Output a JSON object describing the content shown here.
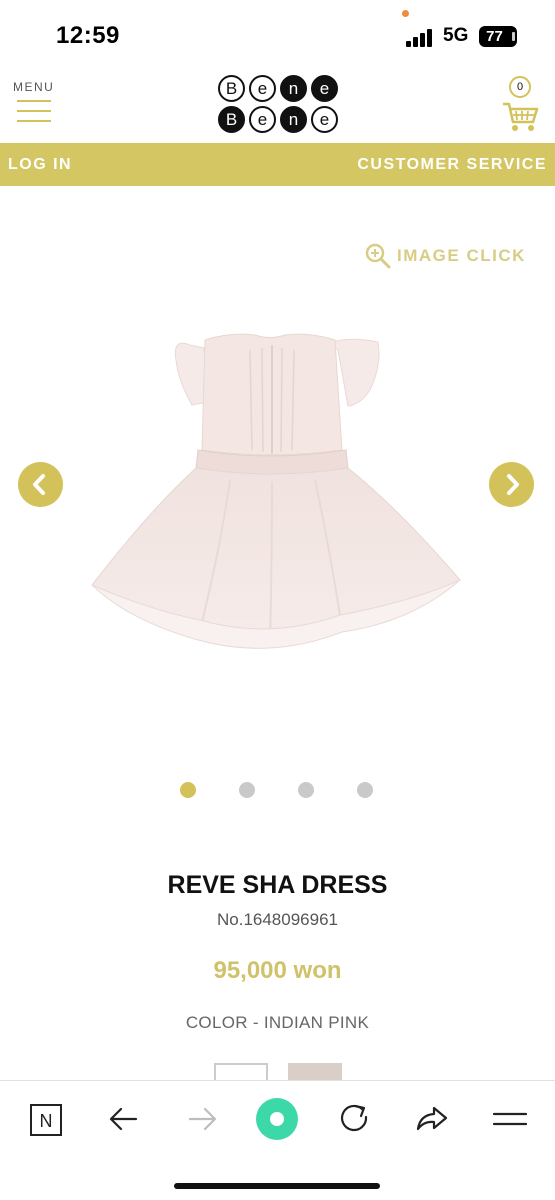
{
  "status_bar": {
    "time": "12:59",
    "network": "5G",
    "battery": "77"
  },
  "header": {
    "menu_label": "MENU",
    "menu_icon": "hamburger-icon",
    "logo_row1": [
      "B",
      "e",
      "n",
      "e"
    ],
    "logo_row2": [
      "B",
      "e",
      "n",
      "e"
    ],
    "cart_count": "0",
    "cart_icon": "cart-icon"
  },
  "topbar": {
    "login": "LOG IN",
    "customer_service": "CUSTOMER SERVICE"
  },
  "gallery": {
    "image_click_label": "IMAGE CLICK",
    "zoom_icon": "zoom-in-icon",
    "prev_icon": "chevron-left-icon",
    "next_icon": "chevron-right-icon",
    "slide_count": 4,
    "active_slide": 1
  },
  "product": {
    "name": "REVE SHA DRESS",
    "number": "No.1648096961",
    "price": "95,000 won",
    "color": "COLOR - INDIAN PINK",
    "swatches": [
      "white",
      "indian-pink"
    ]
  },
  "browser_bar": {
    "icons": [
      "naver-n-icon",
      "back-arrow-icon",
      "forward-arrow-icon",
      "home-circle-icon",
      "refresh-icon",
      "share-icon",
      "menu-icon"
    ]
  },
  "colors": {
    "accent": "#d4c662",
    "price": "#d0c26a",
    "home_button": "#3cd8a8"
  }
}
